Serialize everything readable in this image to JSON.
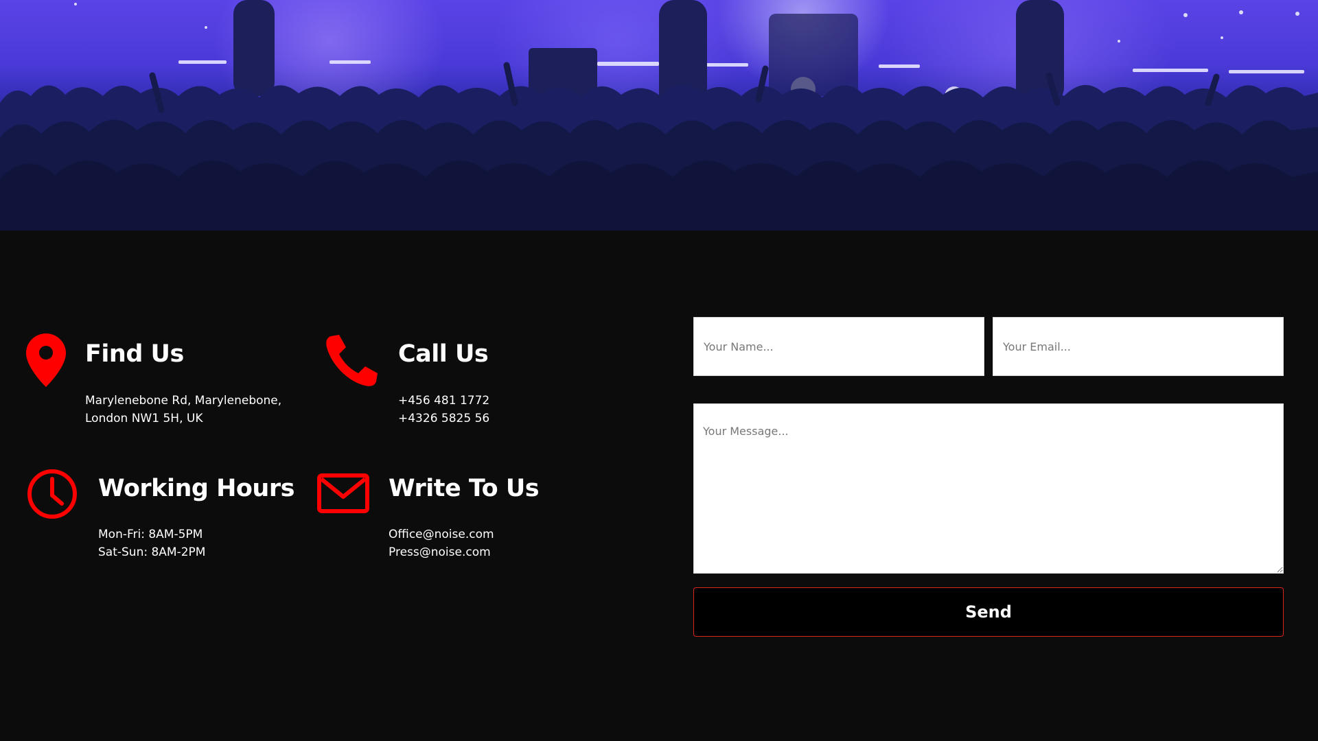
{
  "contact": {
    "find_us": {
      "icon": "map-pin-icon",
      "title": "Find Us",
      "lines": [
        "Marylenebone Rd, Marylenebone,",
        "London NW1 5H, UK"
      ]
    },
    "call_us": {
      "icon": "phone-icon",
      "title": "Call Us",
      "lines": [
        "+456 481 1772",
        "+4326 5825 56"
      ]
    },
    "working_hours": {
      "icon": "clock-icon",
      "title": "Working Hours",
      "lines": [
        "Mon-Fri: 8AM-5PM",
        "Sat-Sun: 8AM-2PM"
      ]
    },
    "write_to_us": {
      "icon": "envelope-icon",
      "title": "Write To Us",
      "lines": [
        "Office@noise.com",
        "Press@noise.com"
      ]
    }
  },
  "form": {
    "name_placeholder": "Your Name...",
    "name_value": "",
    "email_placeholder": "Your Email...",
    "email_value": "",
    "message_placeholder": "Your Message...",
    "message_value": "",
    "send_label": "Send"
  },
  "colors": {
    "accent": "#ff0000",
    "background": "#0c0c0c",
    "button_border": "#d8261a"
  }
}
